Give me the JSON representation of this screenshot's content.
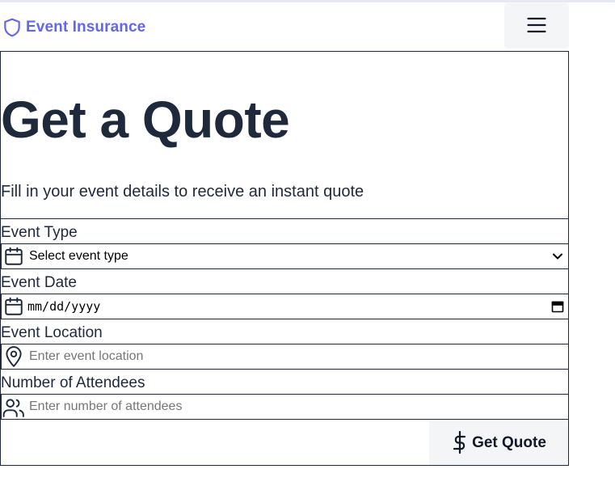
{
  "header": {
    "brand_name": "Event Insurance",
    "brand_icon": "shield-icon",
    "menu_icon": "hamburger-menu-icon"
  },
  "form": {
    "title": "Get a Quote",
    "subtitle": "Fill in your event details to receive an instant quote",
    "event_type": {
      "label": "Event Type",
      "selected": "Select event type",
      "icon": "calendar-icon"
    },
    "event_date": {
      "label": "Event Date",
      "value": "mm/dd/yyyy",
      "icon": "calendar-icon"
    },
    "event_location": {
      "label": "Event Location",
      "placeholder": "Enter event location",
      "icon": "map-pin-icon"
    },
    "attendees": {
      "label": "Number of Attendees",
      "placeholder": "Enter number of attendees",
      "icon": "users-icon"
    },
    "submit": {
      "label": "Get Quote",
      "icon": "dollar-icon"
    }
  },
  "colors": {
    "brand": "#6366f1",
    "text": "#1e293b",
    "button_bg": "#f4f5f7"
  }
}
